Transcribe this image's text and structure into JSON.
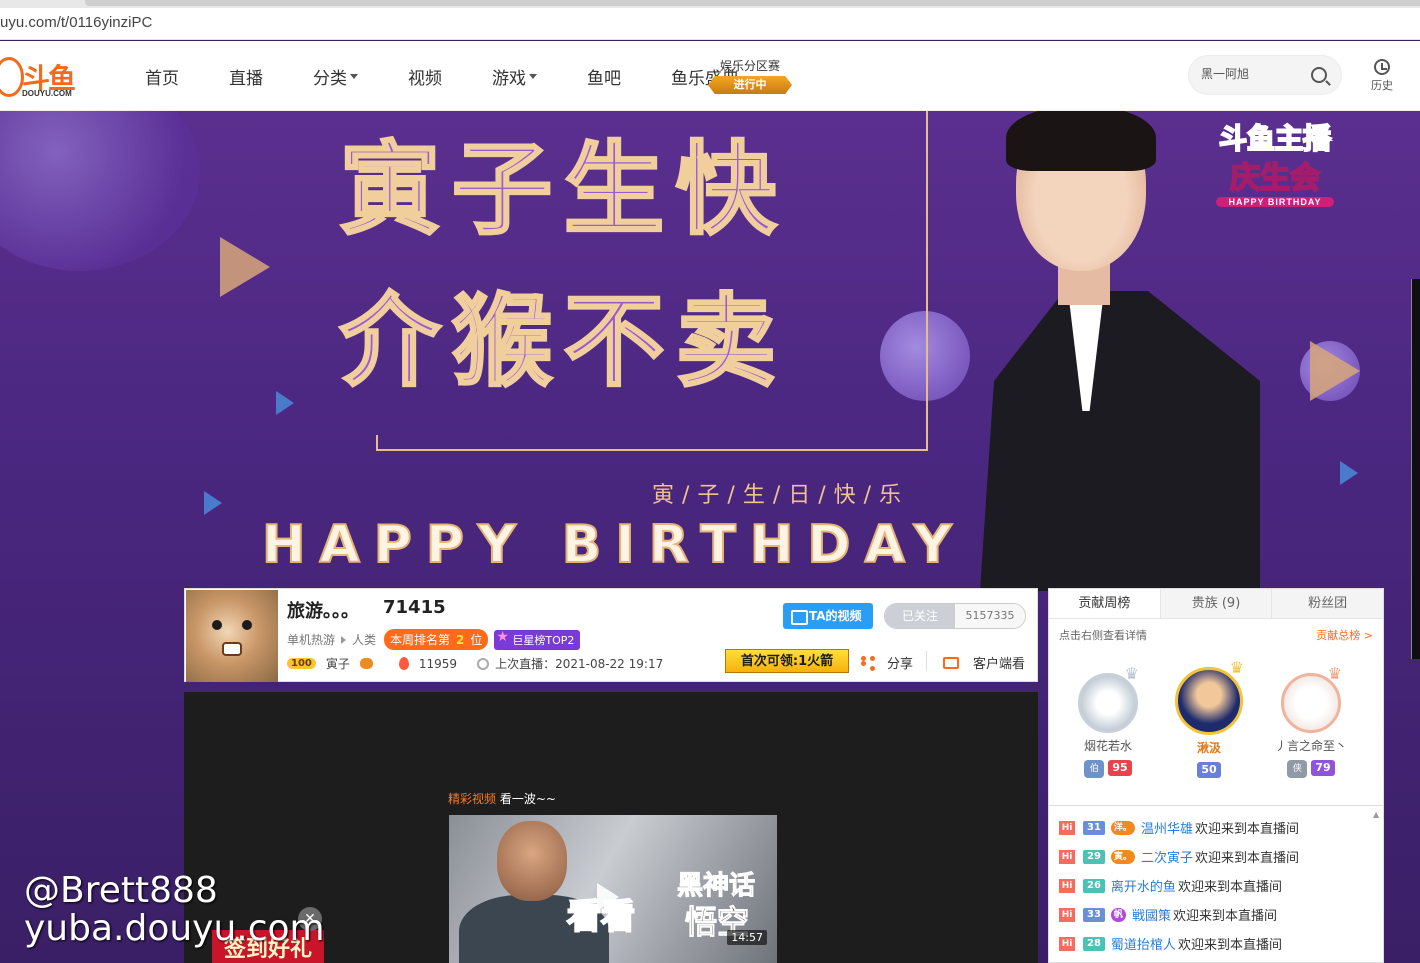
{
  "browser": {
    "url": "uyu.com/t/0116yinziPC"
  },
  "header": {
    "logo": {
      "brand": "斗鱼",
      "sub": "DOUYU.COM"
    },
    "nav": [
      {
        "label": "首页",
        "dropdown": false
      },
      {
        "label": "直播",
        "dropdown": false
      },
      {
        "label": "分类",
        "dropdown": true
      },
      {
        "label": "视频",
        "dropdown": false
      },
      {
        "label": "游戏",
        "dropdown": true
      },
      {
        "label": "鱼吧",
        "dropdown": false
      },
      {
        "label": "鱼乐盛典",
        "dropdown": false
      }
    ],
    "event": {
      "title": "娱乐分区赛",
      "badge": "进行中"
    },
    "search": {
      "value": "黑一阿旭"
    },
    "history_label": "历史"
  },
  "banner": {
    "title_line1": "寅子生快",
    "title_line2": "介猴不卖",
    "subtitle": "寅/子/生/日/快/乐",
    "happy_birthday": "HAPPY BIRTHDAY",
    "logo": {
      "line1": "斗鱼主播",
      "line2": "庆生会",
      "line3": "HAPPY BIRTHDAY"
    }
  },
  "room": {
    "title": "旅游。。。",
    "room_id": "71415",
    "category_parent": "单机热游",
    "category": "人类",
    "weekly_rank_label": "本周排名第",
    "weekly_rank_num": "2",
    "weekly_rank_unit": "位",
    "star_rank": "巨星榜TOP2",
    "level": "100",
    "anchor_name": "寅子",
    "heat": "11959",
    "last_live": "上次直播：2021-08-22 19:17",
    "ta_video_btn": "TA的视频",
    "follow_label": "已关注",
    "follow_count": "5157335",
    "reward_text": "首次可领:1火箭",
    "share_label": "分享",
    "client_label": "客户端看"
  },
  "player": {
    "label_highlight": "精彩视频",
    "label_rest": " 看一波~~",
    "thumb": {
      "text1": "黑神话",
      "text2": "看看",
      "text3": "悟空",
      "duration": "14:57"
    }
  },
  "watermark": {
    "line1": "@Brett888",
    "line2": "yuba.douyu.com"
  },
  "signin_label": "签到好礼",
  "rank_panel": {
    "tabs": [
      "贡献周榜",
      "贵族 (9)",
      "粉丝团"
    ],
    "hint": "点击右侧查看详情",
    "more": "贡献总榜 >",
    "top3": [
      {
        "name": "烟花若水",
        "badge1": "伯",
        "level": "95",
        "level_color": "#e8434a"
      },
      {
        "name": "湫汲",
        "badge1": "",
        "level": "50",
        "level_color": "#6a7fd8"
      },
      {
        "name": "丿言之命至丶",
        "badge1": "侠",
        "level": "79",
        "level_color": "#8f54d8"
      }
    ]
  },
  "chat": [
    {
      "level": "31",
      "level_color": "#6a8fd8",
      "fan": "洋。",
      "fan_color": "#f08a1f",
      "user": "温州华雄",
      "msg": "欢迎来到本直播间"
    },
    {
      "level": "29",
      "level_color": "#4bc2b4",
      "fan": "寅。",
      "fan_color": "#f08a1f",
      "user": "二次寅子",
      "msg": "欢迎来到本直播间"
    },
    {
      "level": "26",
      "level_color": "#4bc2b4",
      "fan": "",
      "fan_color": "",
      "user": "离开水的鱼",
      "msg": "欢迎来到本直播间"
    },
    {
      "level": "33",
      "level_color": "#6a8fd8",
      "fan": "帆",
      "fan_color": "#b04bd8",
      "user": "戦國策",
      "msg": "欢迎来到本直播间"
    },
    {
      "level": "28",
      "level_color": "#4bc2b4",
      "fan": "",
      "fan_color": "",
      "user": "蜀道抬棺人",
      "msg": "欢迎来到本直播间"
    }
  ]
}
